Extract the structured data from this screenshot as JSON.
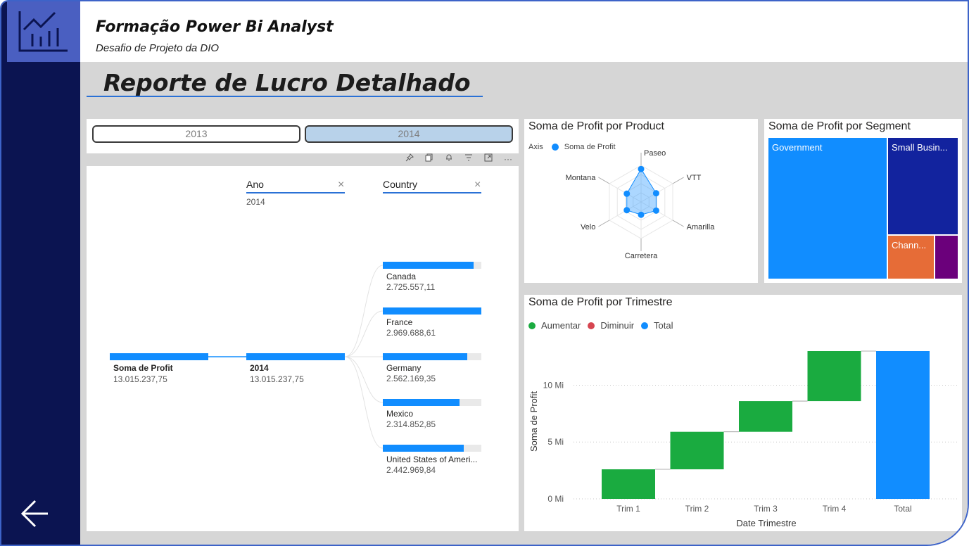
{
  "header": {
    "title": "Formação Power Bi Analyst",
    "subtitle": "Desafio de Projeto da DIO"
  },
  "page": {
    "title": "Reporte de Lucro Detalhado"
  },
  "slicer": {
    "options": [
      "2013",
      "2014"
    ],
    "selected": "2014"
  },
  "visual_toolbar": [
    "pin-icon",
    "copy-icon",
    "bell-icon",
    "filter-icon",
    "focus-mode-icon",
    "more-options-icon"
  ],
  "decomposition": {
    "root": {
      "label": "Soma de Profit",
      "value": "13.015.237,75"
    },
    "levels": [
      {
        "header": "Ano",
        "selected": "2014"
      },
      {
        "header": "Country",
        "selected": ""
      }
    ],
    "level1_node": {
      "label": "2014",
      "value": "13.015.237,75"
    },
    "countries": [
      {
        "label": "Canada",
        "value": "2.725.557,11",
        "share": 0.92
      },
      {
        "label": "France",
        "value": "2.969.688,61",
        "share": 1.0
      },
      {
        "label": "Germany",
        "value": "2.562.169,35",
        "share": 0.86
      },
      {
        "label": "Mexico",
        "value": "2.314.852,85",
        "share": 0.78
      },
      {
        "label": "United States of Ameri...",
        "value": "2.442.969,84",
        "share": 0.82
      }
    ]
  },
  "radar": {
    "title": "Soma de Profit por Product",
    "legend_axis": "Axis",
    "legend_series": "Soma de Profit",
    "color": "#118dff"
  },
  "segment": {
    "title": "Soma de Profit por Segment",
    "items": [
      {
        "label": "Government",
        "color": "#118dff"
      },
      {
        "label": "Small Busin...",
        "color": "#12239e"
      },
      {
        "label": "Chann...",
        "color": "#e66c37"
      },
      {
        "label": "",
        "color": "#6b007b"
      }
    ]
  },
  "waterfall": {
    "title": "Soma de Profit por Trimestre",
    "legend": [
      {
        "label": "Aumentar",
        "color": "#1aab40"
      },
      {
        "label": "Diminuir",
        "color": "#d64550"
      },
      {
        "label": "Total",
        "color": "#118dff"
      }
    ]
  },
  "chart_data": [
    {
      "type": "radar",
      "title": "Soma de Profit por Product",
      "categories": [
        "Paseo",
        "VTT",
        "Amarilla",
        "Carretera",
        "Velo",
        "Montana"
      ],
      "series": [
        {
          "name": "Soma de Profit",
          "values": [
            3.6,
            1.9,
            1.9,
            1.4,
            1.8,
            1.8
          ]
        }
      ],
      "unit": "Mi"
    },
    {
      "type": "bar",
      "title": "Soma de Profit por Trimestre",
      "xlabel": "Date Trimestre",
      "ylabel": "Soma de Profit",
      "categories": [
        "Trim 1",
        "Trim 2",
        "Trim 3",
        "Trim 4",
        "Total"
      ],
      "start": [
        0,
        2.6,
        5.9,
        8.6,
        0
      ],
      "end": [
        2.6,
        5.9,
        8.6,
        13.0,
        13.0
      ],
      "kinds": [
        "Aumentar",
        "Aumentar",
        "Aumentar",
        "Aumentar",
        "Total"
      ],
      "yticks": [
        "0 Mi",
        "5 Mi",
        "10 Mi"
      ],
      "ytick_values": [
        0,
        5,
        10
      ],
      "ylim": [
        0,
        13.5
      ],
      "grid": true
    }
  ]
}
